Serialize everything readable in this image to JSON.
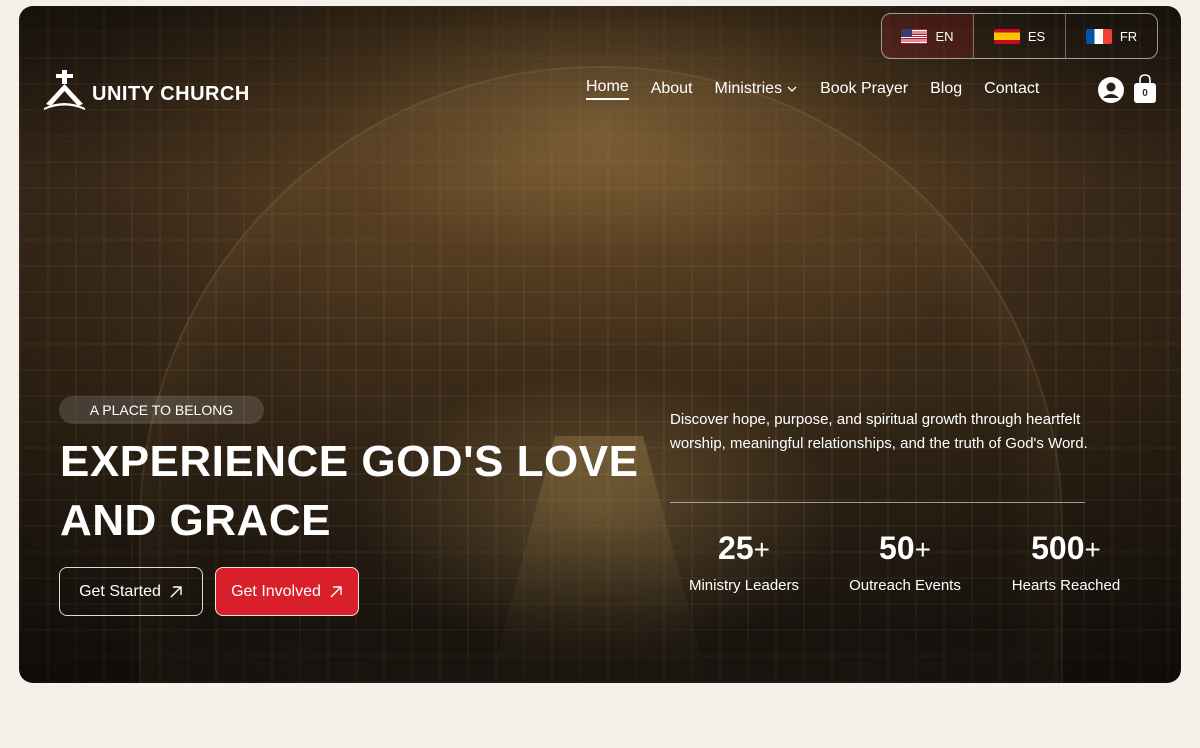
{
  "languages": [
    {
      "code": "EN",
      "active": true
    },
    {
      "code": "ES",
      "active": false
    },
    {
      "code": "FR",
      "active": false
    }
  ],
  "brand": {
    "name": "UNITY CHURCH"
  },
  "nav": {
    "home": "Home",
    "about": "About",
    "ministries": "Ministries",
    "book_prayer": "Book Prayer",
    "blog": "Blog",
    "contact": "Contact"
  },
  "cart": {
    "count": "0"
  },
  "hero": {
    "badge": "A PLACE TO BELONG",
    "headline": "EXPERIENCE GOD'S LOVE AND GRACE",
    "description": "Discover hope, purpose, and spiritual growth through heartfelt worship, meaningful relationships, and the truth of God's Word.",
    "cta_primary": "Get Started",
    "cta_secondary": "Get Involved"
  },
  "stats": [
    {
      "number": "25",
      "suffix": "+",
      "label": "Ministry Leaders"
    },
    {
      "number": "50",
      "suffix": "+",
      "label": "Outreach Events"
    },
    {
      "number": "500",
      "suffix": "+",
      "label": "Hearts Reached"
    }
  ],
  "colors": {
    "accent": "#d91f2a",
    "background": "#f5f1ea"
  }
}
